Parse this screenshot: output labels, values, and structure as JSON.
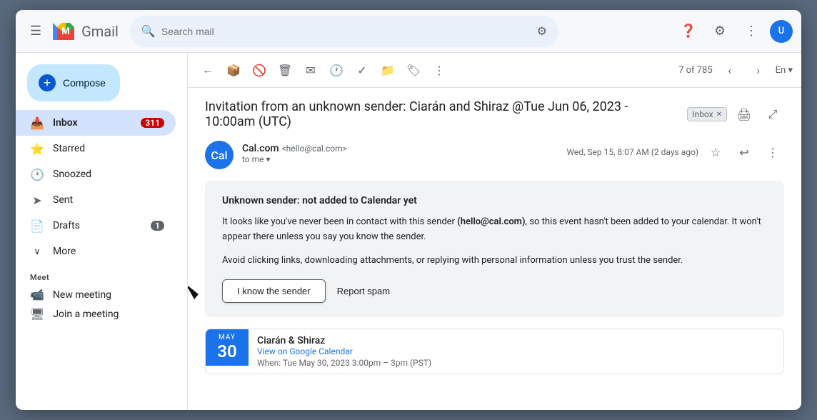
{
  "app": {
    "title": "Gmail"
  },
  "topbar": {
    "search_placeholder": "Search mail",
    "help_icon": "?",
    "settings_icon": "⚙"
  },
  "sidebar": {
    "compose_label": "Compose",
    "nav_items": [
      {
        "id": "inbox",
        "label": "Inbox",
        "icon": "📥",
        "badge": "311",
        "active": true
      },
      {
        "id": "starred",
        "label": "Starred",
        "icon": "⭐",
        "badge": "",
        "active": false
      },
      {
        "id": "snoozed",
        "label": "Snoozed",
        "icon": "🕐",
        "badge": "",
        "active": false
      },
      {
        "id": "sent",
        "label": "Sent",
        "icon": "➤",
        "badge": "",
        "active": false
      },
      {
        "id": "drafts",
        "label": "Drafts",
        "icon": "📄",
        "badge": "1",
        "active": false
      }
    ],
    "more_label": "More",
    "meet_label": "Meet",
    "meet_items": [
      {
        "label": "New meeting",
        "icon": "📹"
      },
      {
        "label": "Join a meeting",
        "icon": "🖥"
      }
    ]
  },
  "email_toolbar": {
    "back_icon": "←",
    "archive_icon": "🗄",
    "spam_icon": "⚠",
    "delete_icon": "🗑",
    "email_icon": "✉",
    "clock_icon": "🕐",
    "check_icon": "✓",
    "folder_icon": "📁",
    "label_icon": "🏷",
    "more_icon": "⋮",
    "counter": "7 of 785",
    "prev_icon": "‹",
    "next_icon": "›",
    "lang": "En"
  },
  "email": {
    "subject": "Invitation from an unknown sender: Ciarán and Shiraz @Tue Jun 06, 2023 - 10:00am (UTC)",
    "inbox_badge": "Inbox",
    "print_icon": "🖨",
    "open_icon": "⤢",
    "sender_avatar": "Cal",
    "sender_name": "Cal.com",
    "sender_email": "<hello@cal.com>",
    "to_label": "to me",
    "date": "Wed, Sep 15, 8:07 AM (2 days ago)",
    "star_icon": "☆",
    "reply_icon": "↩",
    "more_icon": "⋮",
    "warning": {
      "title": "Unknown sender: not added to Calendar yet",
      "body1": "It looks like you've never been in contact with this sender ",
      "body1_bold": "(hello@cal.com)",
      "body1_end": ", so this event hasn't been added to your calendar. It won't appear there unless you say you know the sender.",
      "body2": "Avoid clicking links, downloading attachments, or replying with personal information unless you trust the sender.",
      "know_sender_btn": "I know the sender",
      "report_spam_btn": "Report spam"
    },
    "calendar_card": {
      "month": "May",
      "day": "30",
      "event_title": "Ciarán & Shiraz",
      "view_link": "View on Google Calendar",
      "time_prefix": "When: Tue May 30, 2023 3:00pm – 3pm (PST)"
    }
  }
}
